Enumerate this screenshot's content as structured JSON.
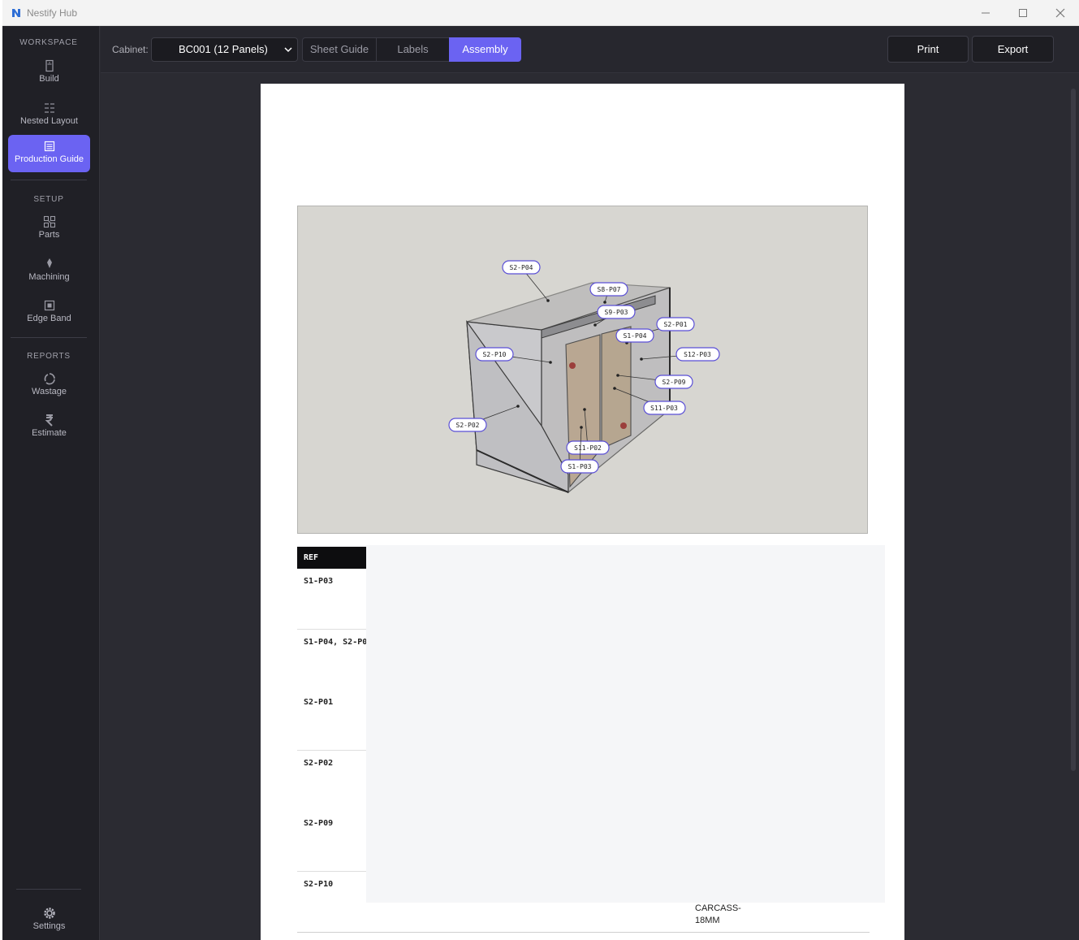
{
  "app": {
    "title": "Nestify Hub"
  },
  "sidebar": {
    "sections": {
      "workspace": "WORKSPACE",
      "setup": "SETUP",
      "reports": "REPORTS"
    },
    "items": [
      {
        "label": "Build",
        "icon": "cabinet-icon"
      },
      {
        "label": "Nested Layout",
        "icon": "nested-layout-icon"
      },
      {
        "label": "Production Guide",
        "icon": "document-icon",
        "active": true
      },
      {
        "label": "Parts",
        "icon": "parts-icon"
      },
      {
        "label": "Machining",
        "icon": "drill-icon"
      },
      {
        "label": "Edge Band",
        "icon": "edge-band-icon"
      },
      {
        "label": "Wastage",
        "icon": "recycle-icon"
      },
      {
        "label": "Estimate",
        "icon": "rupee-icon"
      }
    ],
    "settings": "Settings"
  },
  "toolbar": {
    "cabinet_label": "Cabinet:",
    "cabinet_selected": "BC001 (12 Panels)",
    "tabs": [
      {
        "label": "Sheet Guide"
      },
      {
        "label": "Labels"
      },
      {
        "label": "Assembly",
        "active": true
      }
    ],
    "print_label": "Print",
    "export_label": "Export"
  },
  "assembly": {
    "callouts": [
      "S2-P04",
      "S8-P07",
      "S9-P03",
      "S2-P01",
      "S1-P04",
      "S12-P03",
      "S2-P10",
      "S2-P09",
      "S11-P03",
      "S2-P02",
      "S11-P02",
      "S1-P03"
    ]
  },
  "table": {
    "ref_header": "REF",
    "rows": [
      "S1-P03",
      "S1-P04, S2-P0",
      "S2-P01",
      "S2-P02",
      "S2-P09",
      "S2-P10"
    ],
    "material_line1": "CARCASS-",
    "material_line2": "18MM"
  },
  "colors": {
    "accent": "#6b63f2",
    "sidebar": "#202026",
    "content": "#2b2b32"
  }
}
